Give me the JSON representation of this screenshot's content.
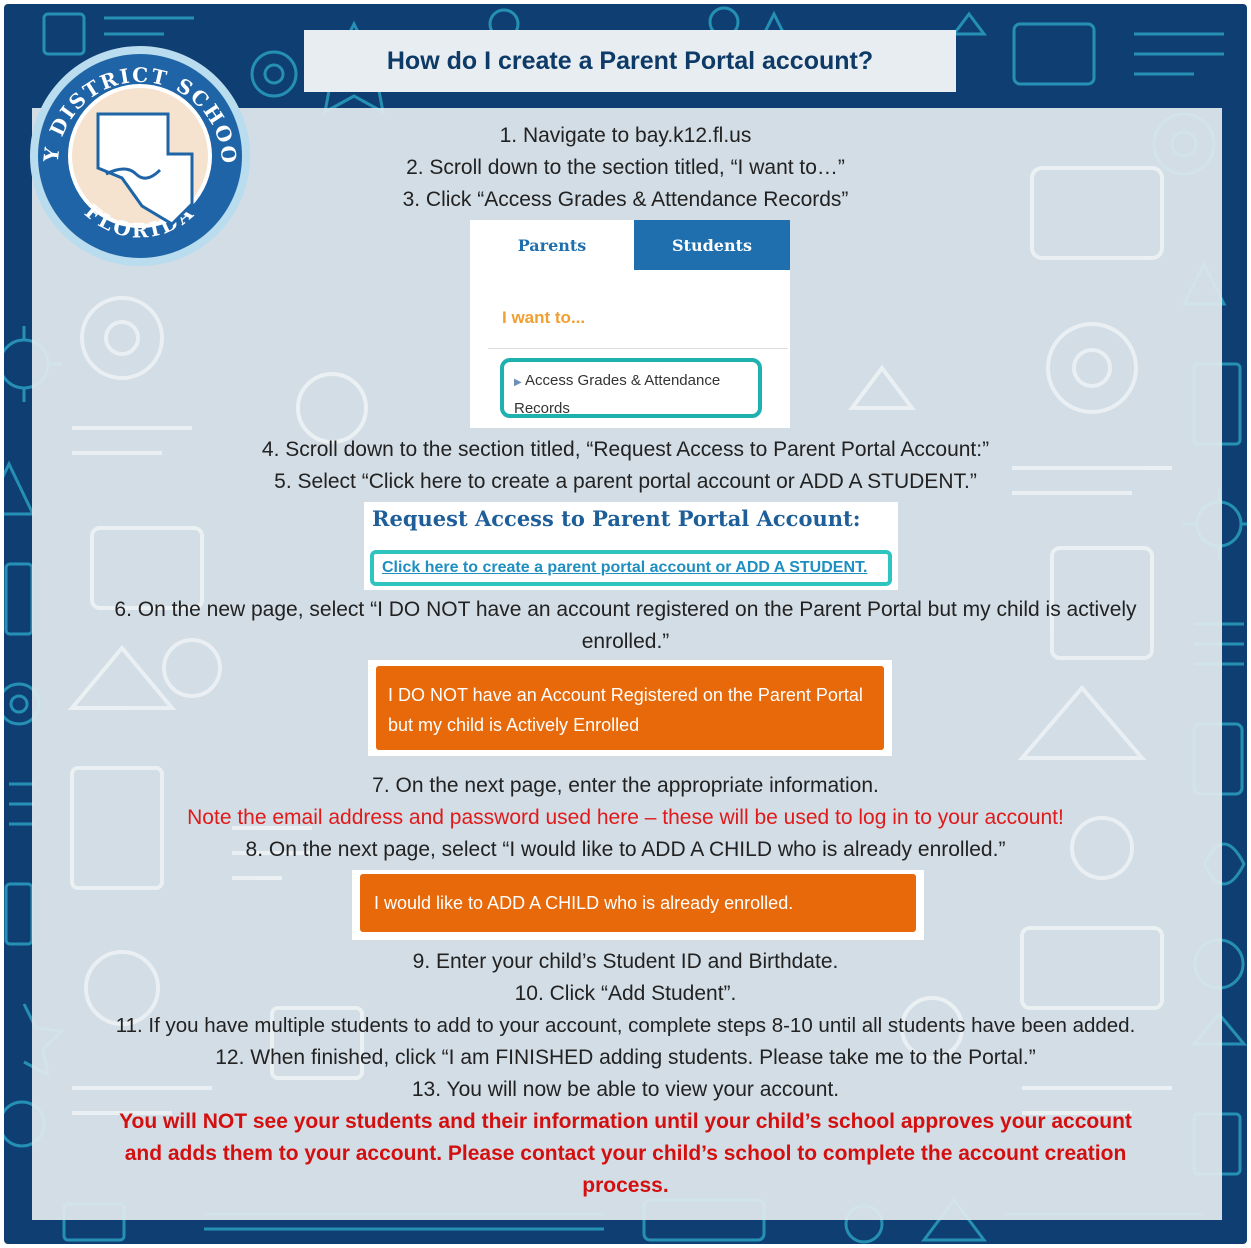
{
  "title": "How do I create a Parent Portal account?",
  "seal": {
    "top_text": "BAY DISTRICT SCHOOLS",
    "bottom_text": "FLORIDA"
  },
  "steps": {
    "s1": "1. Navigate to bay.k12.fl.us",
    "s2": "2. Scroll down to the section titled, “I want to…”",
    "s3": "3. Click “Access Grades & Attendance Records”",
    "s4": "4. Scroll down to the section titled, “Request Access to Parent Portal Account:”",
    "s5": "5. Select “Click here to create a parent portal account or ADD A STUDENT.”",
    "s6a": "6. On the new page, select “I DO NOT have an account registered on the Parent Portal but my child is actively",
    "s6b": "enrolled.”",
    "s7": "7. On the next page, enter the appropriate information.",
    "note": "Note the email address and password used here – these will be used to log in to your account!",
    "s8": "8. On the next page, select “I would like to ADD A CHILD who is already enrolled.”",
    "s9": "9. Enter your child’s Student ID and Birthdate.",
    "s10": "10. Click “Add Student”.",
    "s11": "11. If you have multiple students to add to your account, complete steps 8-10 until all students have been added.",
    "s12": "12. When finished, click “I am FINISHED adding students. Please take me to the Portal.”",
    "s13": "13. You will now be able to view your account.",
    "warning1": "You will NOT see your students and their information until your child’s school approves your account",
    "warning2": "and adds them to your account. Please contact your child’s school to complete the account creation",
    "warning3": "process."
  },
  "screenshot1": {
    "tab_parents": "Parents",
    "tab_students": "Students",
    "want_to": "I want to...",
    "access_line1": "Access Grades & Attendance",
    "access_line2": "Records"
  },
  "screenshot2": {
    "heading": "Request Access to Parent Portal Account:",
    "link": "Click here to create a parent portal account or ADD A STUDENT."
  },
  "button1": {
    "line1": "I DO NOT have an Account Registered on the Parent Portal",
    "line2": "but my child is Actively Enrolled"
  },
  "button2": {
    "label": "I would like to ADD A CHILD who is already enrolled."
  },
  "colors": {
    "navy": "#0f3f72",
    "teal": "#2ec4c0",
    "orange": "#e8690a",
    "red": "#e01a1a",
    "blue": "#1f6fae"
  }
}
